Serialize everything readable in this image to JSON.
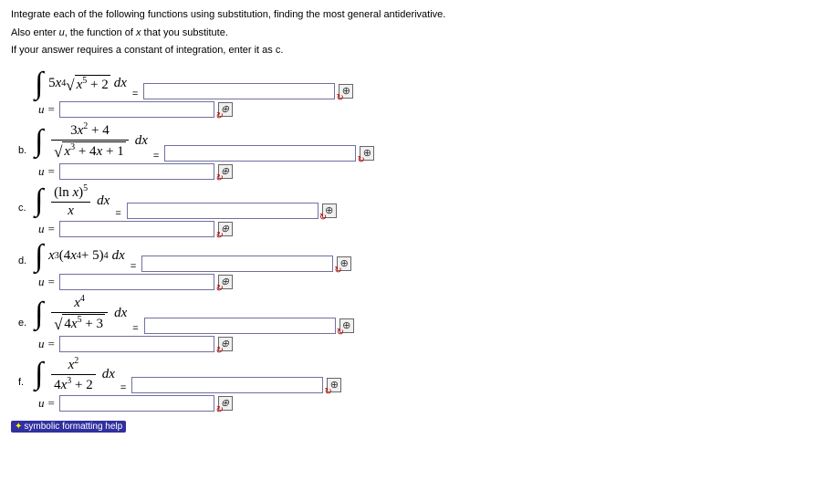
{
  "instructions": {
    "line1": "Integrate each of the following functions using substitution, finding the most general antiderivative.",
    "line2_pre": "Also enter ",
    "line2_u": "u",
    "line2_mid": ", the function of ",
    "line2_x": "x",
    "line2_post": " that you substitute.",
    "line3": "If your answer requires a constant of integration, enter it as c."
  },
  "problems": {
    "a": {
      "label": "",
      "u_label": "u ="
    },
    "b": {
      "label": "b.",
      "u_label": "u ="
    },
    "c": {
      "label": "c.",
      "u_label": "u ="
    },
    "d": {
      "label": "d.",
      "u_label": "u ="
    },
    "e": {
      "label": "e.",
      "u_label": "u ="
    },
    "f": {
      "label": "f.",
      "u_label": "u ="
    }
  },
  "eq": "=",
  "help_text": "symbolic formatting help"
}
